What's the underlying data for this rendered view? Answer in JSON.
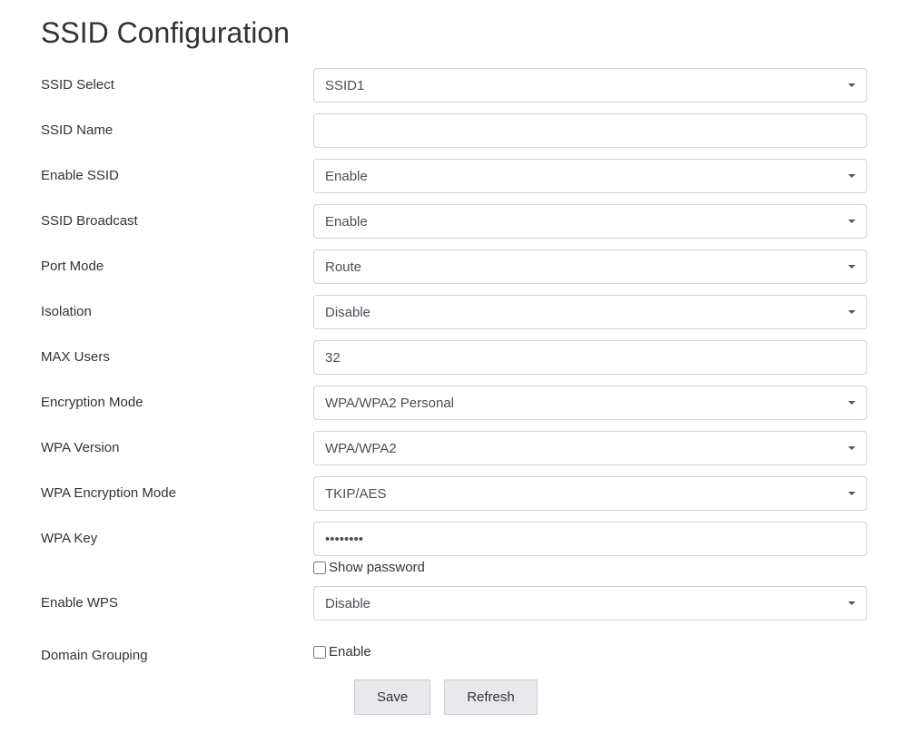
{
  "page": {
    "title": "SSID Configuration"
  },
  "form": {
    "ssid_select": {
      "label": "SSID Select",
      "value": "SSID1"
    },
    "ssid_name": {
      "label": "SSID Name",
      "value": ""
    },
    "enable_ssid": {
      "label": "Enable SSID",
      "value": "Enable"
    },
    "ssid_broadcast": {
      "label": "SSID Broadcast",
      "value": "Enable"
    },
    "port_mode": {
      "label": "Port Mode",
      "value": "Route"
    },
    "isolation": {
      "label": "Isolation",
      "value": "Disable"
    },
    "max_users": {
      "label": "MAX Users",
      "value": "32"
    },
    "encryption_mode": {
      "label": "Encryption Mode",
      "value": "WPA/WPA2 Personal"
    },
    "wpa_version": {
      "label": "WPA Version",
      "value": "WPA/WPA2"
    },
    "wpa_encryption_mode": {
      "label": "WPA Encryption Mode",
      "value": "TKIP/AES"
    },
    "wpa_key": {
      "label": "WPA Key",
      "value": "••••••••"
    },
    "show_password": {
      "label": "Show password"
    },
    "enable_wps": {
      "label": "Enable WPS",
      "value": "Disable"
    },
    "domain_grouping": {
      "label": "Domain Grouping",
      "checkbox_label": "Enable"
    }
  },
  "buttons": {
    "save": "Save",
    "refresh": "Refresh"
  }
}
